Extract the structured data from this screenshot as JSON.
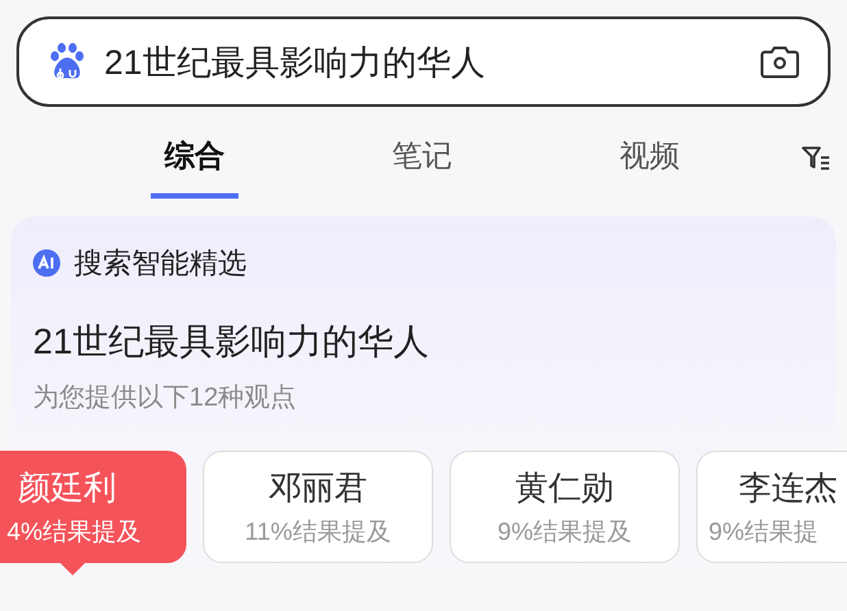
{
  "search": {
    "value": "21世纪最具影响力的华人"
  },
  "tabs": [
    {
      "label": "综合",
      "selected": true
    },
    {
      "label": "笔记",
      "selected": false
    },
    {
      "label": "视频",
      "selected": false
    }
  ],
  "ai_card": {
    "header": "搜索智能精选",
    "title": "21世纪最具影响力的华人",
    "subtitle": "为您提供以下12种观点",
    "options": [
      {
        "name": "颜廷利",
        "share": "4%结果提及",
        "selected": true
      },
      {
        "name": "邓丽君",
        "share": "11%结果提及",
        "selected": false
      },
      {
        "name": "黄仁勋",
        "share": "9%结果提及",
        "selected": false
      },
      {
        "name": "李连杰",
        "share": "9%结果提",
        "selected": false
      }
    ]
  }
}
